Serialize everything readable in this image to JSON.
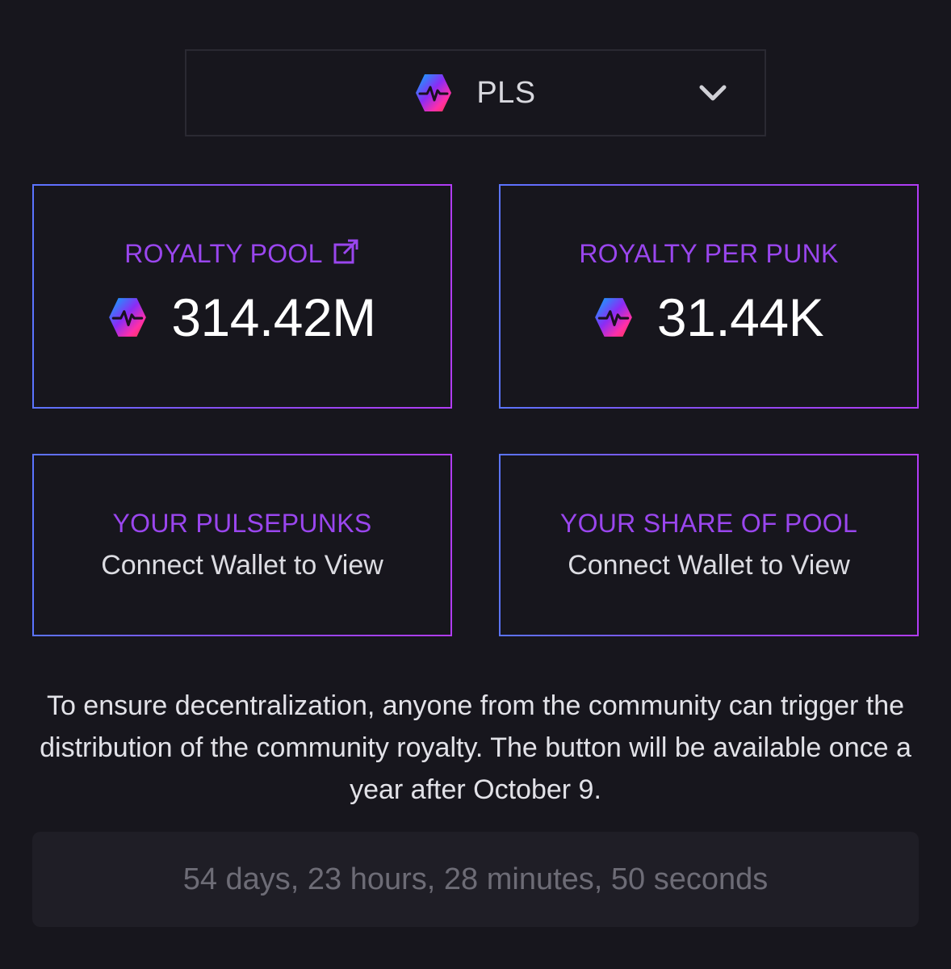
{
  "token_select": {
    "selected": "PLS",
    "token_icon": "pulsechain-logo-icon",
    "chevron_icon": "chevron-down-icon"
  },
  "cards": {
    "royalty_pool": {
      "title": "ROYALTY POOL",
      "value": "314.42M",
      "link_icon": "external-link-icon"
    },
    "royalty_per_punk": {
      "title": "ROYALTY PER PUNK",
      "value": "31.44K"
    },
    "your_pulsepunks": {
      "title": "YOUR PULSEPUNKS",
      "value": "Connect Wallet to View"
    },
    "your_share": {
      "title": "YOUR SHARE OF POOL",
      "value": "Connect Wallet to View"
    }
  },
  "note": "To ensure decentralization, anyone from the community can trigger the distribution of the community royalty. The button will be available once a year after October 9.",
  "countdown": "54 days, 23 hours, 28 minutes, 50 seconds",
  "colors": {
    "background": "#17161d",
    "accent": "#9a46ee",
    "border_gradient_start": "#5b74ff",
    "border_gradient_end": "#b13cf5"
  }
}
